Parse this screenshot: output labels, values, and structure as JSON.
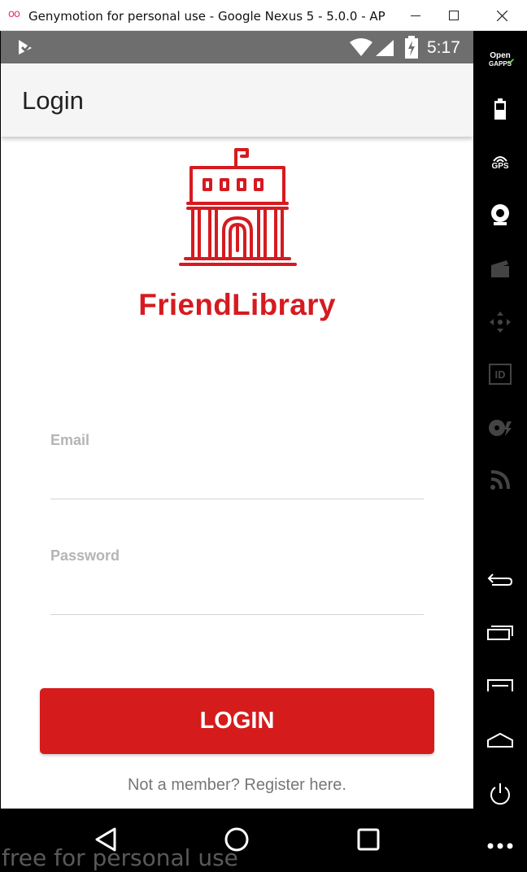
{
  "window": {
    "title": "Genymotion for personal use - Google Nexus 5 - 5.0.0 - API 2...",
    "logo": "oo"
  },
  "statusbar": {
    "time": "5:17"
  },
  "appbar": {
    "title": "Login"
  },
  "brand": {
    "name": "FriendLibrary",
    "color": "#d51b20"
  },
  "form": {
    "email_label": "Email",
    "email_value": "",
    "password_label": "Password",
    "password_value": "",
    "login_label": "LOGIN",
    "register_text": "Not a member? Register here."
  },
  "sidebar": {
    "open_gapps_line1": "Open",
    "open_gapps_line2": "GAPPS",
    "gps_label": "GPS",
    "id_label": "ID"
  },
  "watermark": "free for personal use",
  "colors": {
    "accent": "#d51b1c",
    "statusbar": "#6e6e6e",
    "appbar": "#f5f5f5"
  }
}
